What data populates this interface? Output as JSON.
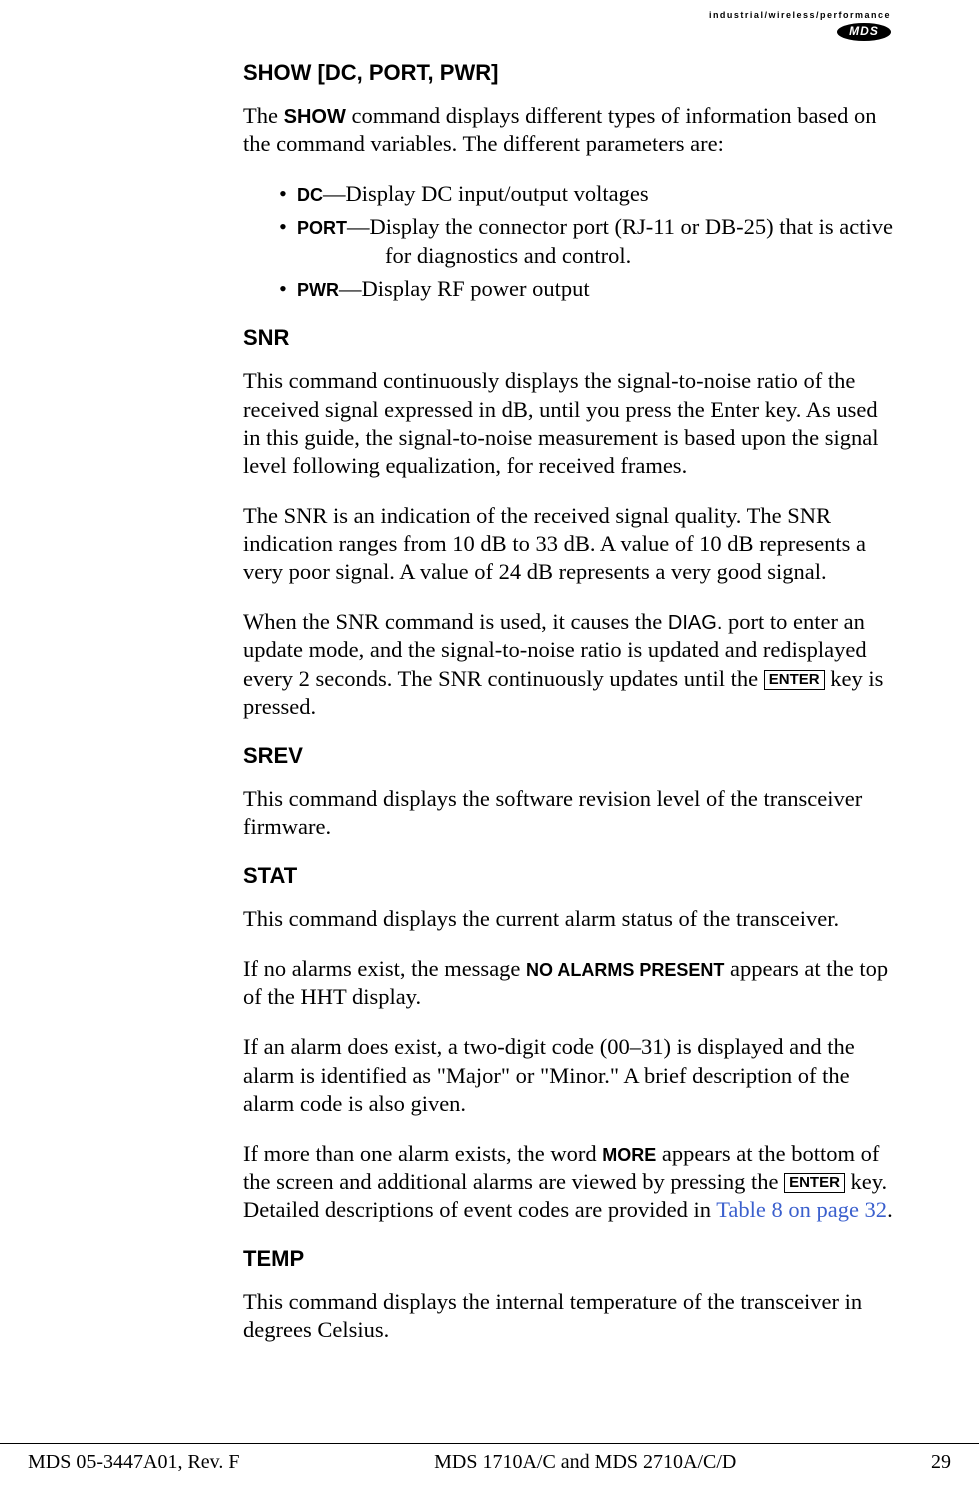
{
  "logo": {
    "top": "industrial/wireless/performance",
    "brand": "MDS"
  },
  "sections": {
    "show": {
      "heading": "SHOW [DC, PORT, PWR]",
      "intro_a": "The ",
      "intro_cmd": "SHOW",
      "intro_b": " command displays different types of information based on the command variables. The different parameters are:",
      "items": {
        "dc": {
          "name": "DC",
          "desc": "—Display DC input/output voltages"
        },
        "port": {
          "name": "PORT",
          "desc_a": "—Display the connector port (RJ-11 or DB-25) that is active",
          "desc_cont": "for diagnostics and control."
        },
        "pwr": {
          "name": "PWR",
          "desc": "—Display RF power output"
        }
      }
    },
    "snr": {
      "heading": "SNR",
      "p1": "This command continuously displays the signal-to-noise ratio of the received signal expressed in dB, until you press the Enter key. As used in this guide, the signal-to-noise measurement is based upon the signal level following equalization, for received frames.",
      "p2": "The SNR is an indication of the received signal quality. The SNR indication ranges from 10 dB to 33 dB. A value of 10 dB represents a very poor signal. A value of 24 dB represents a very good signal.",
      "p3_a": "When the SNR command is used, it causes the ",
      "p3_diag": "DIAG.",
      "p3_b": " port to enter an update mode, and the signal-to-noise ratio is updated and redisplayed every 2 seconds. The SNR continuously updates until the ",
      "p3_key": "ENTER",
      "p3_c": " key is pressed."
    },
    "srev": {
      "heading": "SREV",
      "p1": "This command displays the software revision level of the transceiver firmware."
    },
    "stat": {
      "heading": "STAT",
      "p1": "This command displays the current alarm status of the transceiver.",
      "p2_a": "If no alarms exist, the message ",
      "p2_msg": "NO ALARMS PRESENT",
      "p2_b": " appears at the top of the HHT display.",
      "p3": "If an alarm does exist, a two-digit code (00–31) is displayed and the alarm is identified as \"Major\" or \"Minor.\" A brief description of the alarm code is also given.",
      "p4_a": "If more than one alarm exists, the word ",
      "p4_more": "MORE",
      "p4_b": " appears at the bottom of the screen and additional alarms are viewed by pressing the ",
      "p4_key": "ENTER",
      "p4_c": " key. Detailed descriptions of event codes are provided in ",
      "p4_link": "Table 8 on page 32",
      "p4_d": "."
    },
    "temp": {
      "heading": "TEMP",
      "p1": "This command displays the internal temperature of the transceiver in degrees Celsius."
    }
  },
  "footer": {
    "left": "MDS 05-3447A01, Rev. F",
    "center": "MDS 1710A/C and MDS 2710A/C/D",
    "right": "29"
  }
}
